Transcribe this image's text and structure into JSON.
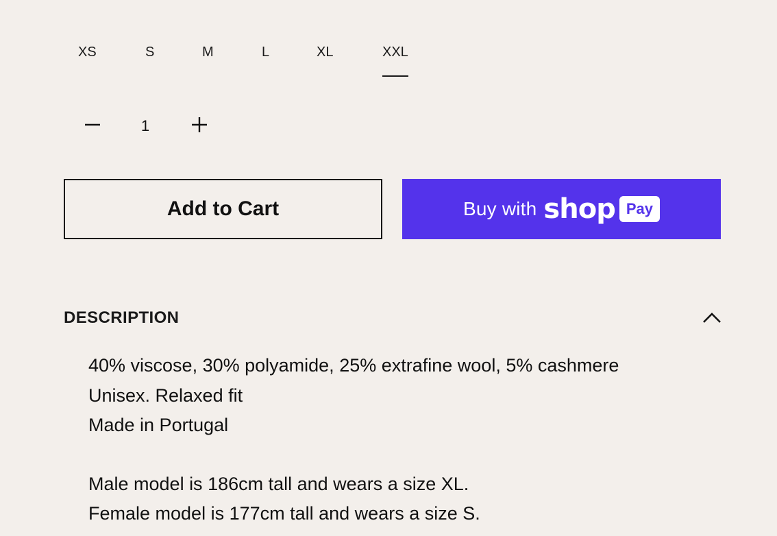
{
  "sizes": {
    "options": [
      "XS",
      "S",
      "M",
      "L",
      "XL",
      "XXL"
    ],
    "selected": "XXL"
  },
  "quantity": {
    "value": "1",
    "decrement_icon": "minus-icon",
    "increment_icon": "plus-icon"
  },
  "buttons": {
    "add_to_cart": "Add to Cart",
    "shop_pay_prefix": "Buy with",
    "shop_pay_brand": "shop",
    "shop_pay_badge": "Pay",
    "shop_pay_color": "#5433eb"
  },
  "description": {
    "title": "DESCRIPTION",
    "toggle_icon": "chevron-up-icon",
    "lines": [
      "40% viscose, 30% polyamide, 25% extrafine wool, 5% cashmere",
      "Unisex. Relaxed fit",
      "Made in Portugal",
      "Male model is 186cm tall and wears a size XL.",
      "Female model is 177cm tall and wears a size S."
    ]
  },
  "colors": {
    "background": "#f3efeb",
    "text": "#111111",
    "accent": "#5433eb"
  }
}
